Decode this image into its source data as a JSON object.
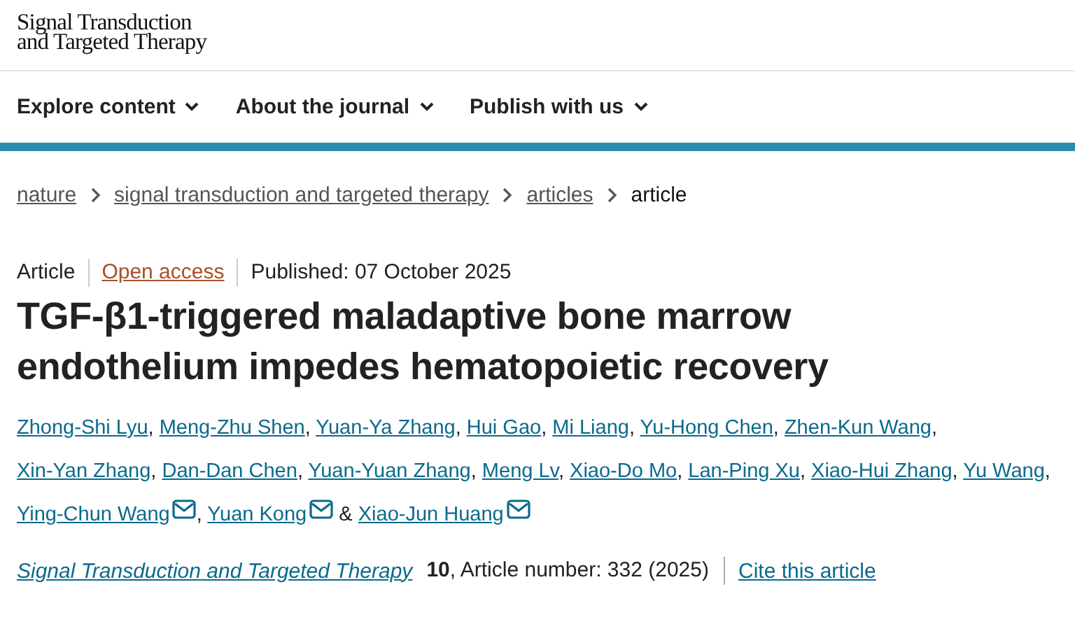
{
  "header": {
    "logo": [
      "Signal Transduction",
      "and Targeted Therapy"
    ]
  },
  "nav": [
    {
      "label": "Explore content"
    },
    {
      "label": "About the journal"
    },
    {
      "label": "Publish with us"
    }
  ],
  "breadcrumbs": [
    {
      "label": "nature",
      "kind": "link"
    },
    {
      "label": "signal transduction and targeted therapy",
      "kind": "link"
    },
    {
      "label": "articles",
      "kind": "link"
    },
    {
      "label": "article",
      "kind": "current"
    }
  ],
  "meta": {
    "type": "Article",
    "access": "Open access",
    "published": "Published: 07 October 2025"
  },
  "title": "TGF-β1-triggered maladaptive bone marrow endothelium impedes hematopoietic recovery",
  "author_separator": ",",
  "author_last_separator": "&",
  "authors": [
    {
      "name": "Zhong-Shi Lyu",
      "email": false
    },
    {
      "name": "Meng-Zhu Shen",
      "email": false
    },
    {
      "name": "Yuan-Ya Zhang",
      "email": false
    },
    {
      "name": "Hui Gao",
      "email": false
    },
    {
      "name": "Mi Liang",
      "email": false
    },
    {
      "name": "Yu-Hong Chen",
      "email": false
    },
    {
      "name": "Zhen-Kun Wang",
      "email": false
    },
    {
      "name": "Xin-Yan Zhang",
      "email": false
    },
    {
      "name": "Dan-Dan Chen",
      "email": false
    },
    {
      "name": "Yuan-Yuan Zhang",
      "email": false
    },
    {
      "name": "Meng Lv",
      "email": false
    },
    {
      "name": "Xiao-Do Mo",
      "email": false
    },
    {
      "name": "Lan-Ping Xu",
      "email": false
    },
    {
      "name": "Xiao-Hui Zhang",
      "email": false
    },
    {
      "name": "Yu Wang",
      "email": false
    },
    {
      "name": "Ying-Chun Wang",
      "email": true
    },
    {
      "name": "Yuan Kong",
      "email": true
    },
    {
      "name": "Xiao-Jun Huang",
      "email": true
    }
  ],
  "citation": {
    "journal": "Signal Transduction and Targeted Therapy",
    "details": "**10**, Article number: 332 (2025)",
    "cite": "Cite this article"
  }
}
